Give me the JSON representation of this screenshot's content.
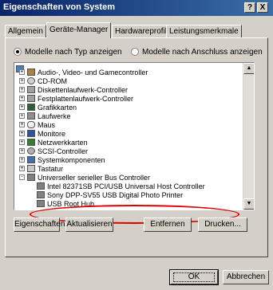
{
  "window": {
    "title": "Eigenschaften von System",
    "help_label": "?",
    "close_label": "X"
  },
  "tabs": [
    {
      "label": "Allgemein",
      "active": false
    },
    {
      "label": "Geräte-Manager",
      "active": true
    },
    {
      "label": "Hardwareprofile",
      "active": false
    },
    {
      "label": "Leistungsmerkmale",
      "active": false
    }
  ],
  "view": {
    "by_type_label": "Modelle nach Typ anzeigen",
    "by_connection_label": "Modelle nach Anschluss anzeigen",
    "selected": "by_type"
  },
  "tree": [
    {
      "label": "Audio-, Video- und Gamecontroller",
      "expander": "+",
      "icon": "speaker-icon"
    },
    {
      "label": "CD-ROM",
      "expander": "+",
      "icon": "cdrom-icon"
    },
    {
      "label": "Diskettenlaufwerk-Controller",
      "expander": "+",
      "icon": "floppy-controller-icon"
    },
    {
      "label": "Festplattenlaufwerk-Controller",
      "expander": "+",
      "icon": "harddisk-controller-icon"
    },
    {
      "label": "Grafikkarten",
      "expander": "+",
      "icon": "display-adapter-icon"
    },
    {
      "label": "Laufwerke",
      "expander": "+",
      "icon": "drive-icon"
    },
    {
      "label": "Maus",
      "expander": "+",
      "icon": "mouse-icon"
    },
    {
      "label": "Monitore",
      "expander": "+",
      "icon": "monitor-icon"
    },
    {
      "label": "Netzwerkkarten",
      "expander": "+",
      "icon": "network-card-icon"
    },
    {
      "label": "SCSI-Controller",
      "expander": "+",
      "icon": "scsi-icon"
    },
    {
      "label": "Systemkomponenten",
      "expander": "+",
      "icon": "system-icon"
    },
    {
      "label": "Tastatur",
      "expander": "+",
      "icon": "keyboard-icon"
    },
    {
      "label": "Universeller serieller Bus Controller",
      "expander": "-",
      "icon": "usb-icon"
    },
    {
      "label": "Intel 82371SB PCI/USB Universal Host Controller",
      "expander": "",
      "icon": "usb-icon"
    },
    {
      "label": "Sony DPP-SV55 USB Digital Photo Printer",
      "expander": "",
      "icon": "usb-icon"
    },
    {
      "label": "USB Root Hub",
      "expander": "",
      "icon": "usb-icon"
    }
  ],
  "buttons": {
    "properties": "Eigenschaften",
    "refresh": "Aktualisieren",
    "remove": "Entfernen",
    "print": "Drucken...",
    "ok": "OK",
    "cancel": "Abbrechen"
  },
  "colors": {
    "title_bar": "#0a246a",
    "annotation_ellipse": "#e00000"
  }
}
